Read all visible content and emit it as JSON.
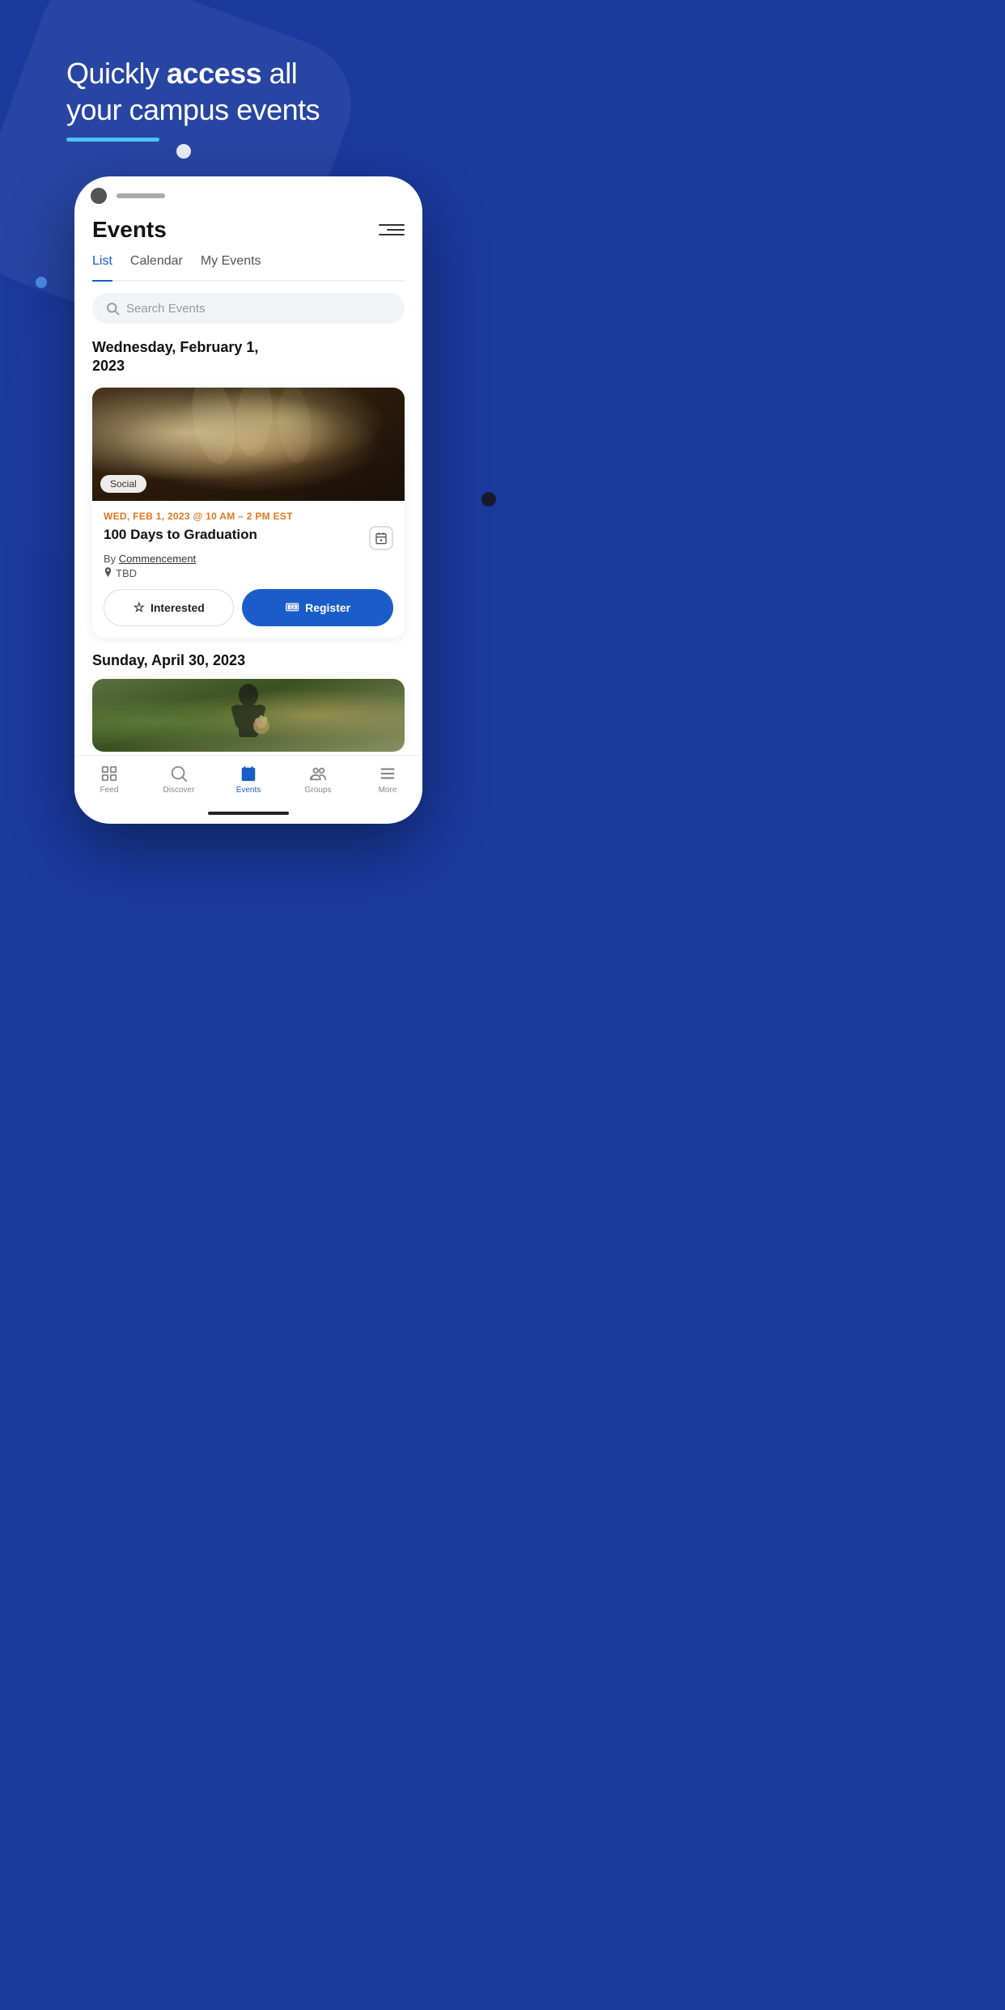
{
  "background": {
    "color": "#1a3a9e"
  },
  "hero": {
    "line1_normal": "Quickly ",
    "line1_bold": "access",
    "line1_end": " all",
    "line2": "your campus events"
  },
  "phone": {
    "app": {
      "title": "Events",
      "tabs": [
        {
          "label": "List",
          "active": true
        },
        {
          "label": "Calendar",
          "active": false
        },
        {
          "label": "My Events",
          "active": false
        }
      ],
      "search": {
        "placeholder": "Search Events"
      },
      "sections": [
        {
          "date_heading": "Wednesday, February 1,\n2023",
          "events": [
            {
              "category": "Social",
              "date_time": "WED, FEB 1, 2023 @ 10 AM – 2 PM EST",
              "name": "100 Days to Graduation",
              "organizer": "By Commencement",
              "location": "TBD",
              "btn_interested": "Interested",
              "btn_register": "Register"
            }
          ]
        },
        {
          "date_heading": "Sunday, April 30, 2023",
          "events": []
        }
      ],
      "bottom_nav": [
        {
          "label": "Feed",
          "active": false,
          "icon": "feed-icon"
        },
        {
          "label": "Discover",
          "active": false,
          "icon": "discover-icon"
        },
        {
          "label": "Events",
          "active": true,
          "icon": "events-icon"
        },
        {
          "label": "Groups",
          "active": false,
          "icon": "groups-icon"
        },
        {
          "label": "More",
          "active": false,
          "icon": "more-icon"
        }
      ]
    }
  }
}
